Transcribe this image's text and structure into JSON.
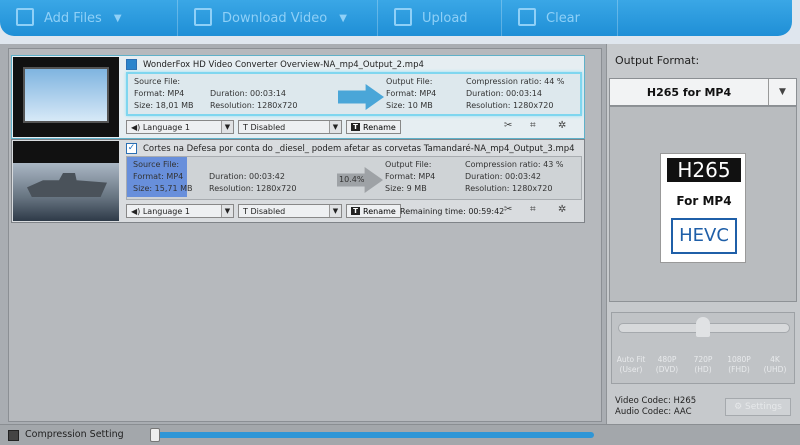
{
  "toolbar": {
    "add_files": "Add Files",
    "download_video": "Download Video",
    "upload": "Upload",
    "clear": "Clear"
  },
  "items": [
    {
      "title": "WonderFox HD Video Converter Overview-NA_mp4_Output_2.mp4",
      "checked": false,
      "source_label": "Source File:",
      "source_format": "Format: MP4",
      "source_duration": "Duration: 00:03:14",
      "source_size": "Size: 18,01 MB",
      "source_resolution": "Resolution: 1280x720",
      "output_label": "Output File:",
      "output_format": "Format: MP4",
      "output_duration": "Duration: 00:03:14",
      "output_size": "Size: 10 MB",
      "output_resolution": "Resolution: 1280x720",
      "compression": "Compression ratio: 44 %",
      "audio": "Language 1",
      "subtitle": "Disabled",
      "rename": "Rename"
    },
    {
      "title": "Cortes na Defesa por conta do _diesel_ podem afetar as corvetas Tamandaré-NA_mp4_Output_3.mp4",
      "checked": true,
      "source_label": "Source File:",
      "source_format": "Format: MP4",
      "source_duration": "Duration: 00:03:42",
      "source_size": "Size: 15,71 MB",
      "source_resolution": "Resolution: 1280x720",
      "progress": "10.4%",
      "output_label": "Output File:",
      "output_format": "Format: MP4",
      "output_duration": "Duration: 00:03:42",
      "output_size": "Size: 9 MB",
      "output_resolution": "Resolution: 1280x720",
      "compression": "Compression ratio: 43 %",
      "audio": "Language 1",
      "subtitle": "Disabled",
      "rename": "Rename",
      "remaining": "Remaining time: 00:59:42"
    }
  ],
  "bottom": {
    "compression_setting": "Compression Setting"
  },
  "right": {
    "output_format_label": "Output Format:",
    "selected_format": "H265 for MP4",
    "card_top": "H265",
    "card_mid": "For MP4",
    "card_bottom": "HEVC",
    "quality_labels": [
      {
        "l1": "Auto Fit",
        "l2": "(User)"
      },
      {
        "l1": "480P",
        "l2": "(DVD)"
      },
      {
        "l1": "720P",
        "l2": "(HD)"
      },
      {
        "l1": "1080P",
        "l2": "(FHD)"
      },
      {
        "l1": "4K",
        "l2": "(UHD)"
      }
    ],
    "video_codec": "Video Codec: H265",
    "audio_codec": "Audio Codec: AAC",
    "settings": "Settings"
  },
  "icons": {
    "check": "✓",
    "dropdown": "▼"
  }
}
